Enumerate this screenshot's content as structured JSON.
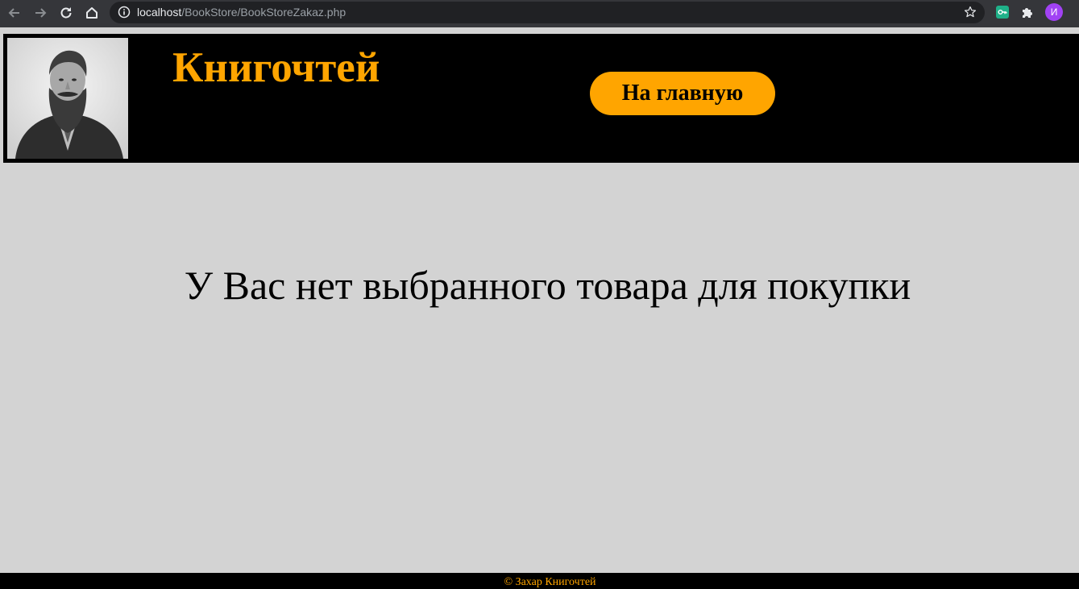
{
  "browser": {
    "url_host": "localhost",
    "url_path": "/BookStore/BookStoreZakaz.php",
    "profile_initial": "И",
    "icons": {
      "back": "arrow-left-icon",
      "forward": "arrow-right-icon",
      "reload": "reload-icon",
      "home": "home-icon",
      "site_info": "info-icon",
      "bookmark": "star-icon",
      "extension": "key-extension-icon",
      "extensions_menu": "puzzle-icon"
    }
  },
  "header": {
    "site_title": "Книгочтей",
    "home_button_label": "На главную",
    "portrait_alt": "portrait"
  },
  "main": {
    "message": "У Вас нет выбранного товара для покупки"
  },
  "footer": {
    "text": "© Захар Книгочтей"
  },
  "colors": {
    "accent": "#ffa500",
    "header_bg": "#000000",
    "page_bg": "#d3d3d3"
  }
}
